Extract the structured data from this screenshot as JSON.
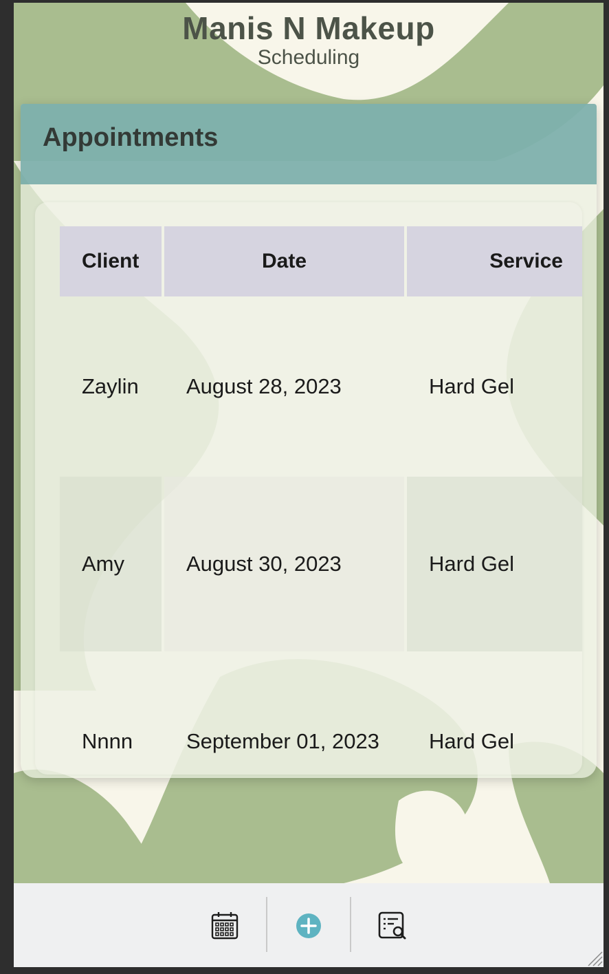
{
  "app": {
    "title": "Manis N Makeup",
    "subtitle": "Scheduling"
  },
  "card": {
    "title": "Appointments"
  },
  "table": {
    "headers": [
      "Client",
      "Date",
      "Service"
    ],
    "rows": [
      [
        "Zaylin",
        "August 28, 2023",
        "Hard Gel"
      ],
      [
        "Amy",
        "August 30, 2023",
        "Hard Gel"
      ],
      [
        "Nnnn",
        "September 01, 2023",
        "Hard Gel"
      ]
    ]
  },
  "nav": {
    "items": [
      {
        "icon": "calendar-icon"
      },
      {
        "icon": "plus-circle-icon"
      },
      {
        "icon": "search-list-icon"
      }
    ]
  },
  "colors": {
    "header_band": "#66a3a2",
    "background_swirl": "#a9bd8f",
    "background_cream": "#f8f6ea",
    "table_header": "#d6d4e0",
    "accent_add": "#5eb3c1"
  }
}
